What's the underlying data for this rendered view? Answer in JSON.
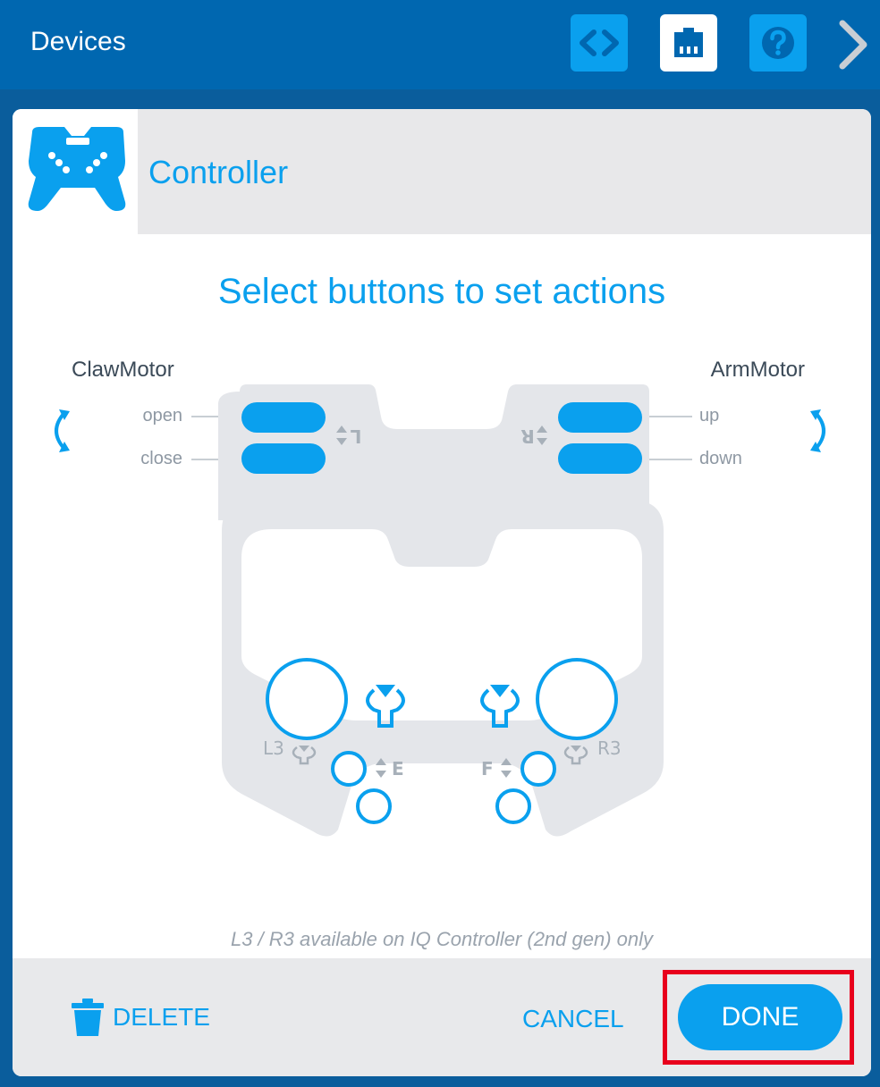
{
  "header": {
    "title": "Devices",
    "buttons": [
      {
        "icon": "code-icon"
      },
      {
        "icon": "port-icon"
      },
      {
        "icon": "help-icon"
      }
    ],
    "next_icon": "chevron-right-icon"
  },
  "device": {
    "name": "Controller",
    "icon": "gamepad-icon"
  },
  "instruction": "Select buttons to set actions",
  "left_motor": {
    "name": "ClawMotor",
    "up_action": "open",
    "down_action": "close",
    "bumper": "L"
  },
  "right_motor": {
    "name": "ArmMotor",
    "up_action": "up",
    "down_action": "down",
    "bumper": "R"
  },
  "controller_labels": {
    "l3": "L3",
    "r3": "R3",
    "e": "E",
    "f": "F"
  },
  "note": "L3 / R3 available on IQ Controller (2nd gen) only",
  "footer": {
    "delete_label": "DELETE",
    "cancel_label": "CANCEL",
    "done_label": "DONE"
  },
  "colors": {
    "accent": "#0aa0ee",
    "header_bg": "#0067b0",
    "highlight": "#e8001c"
  }
}
